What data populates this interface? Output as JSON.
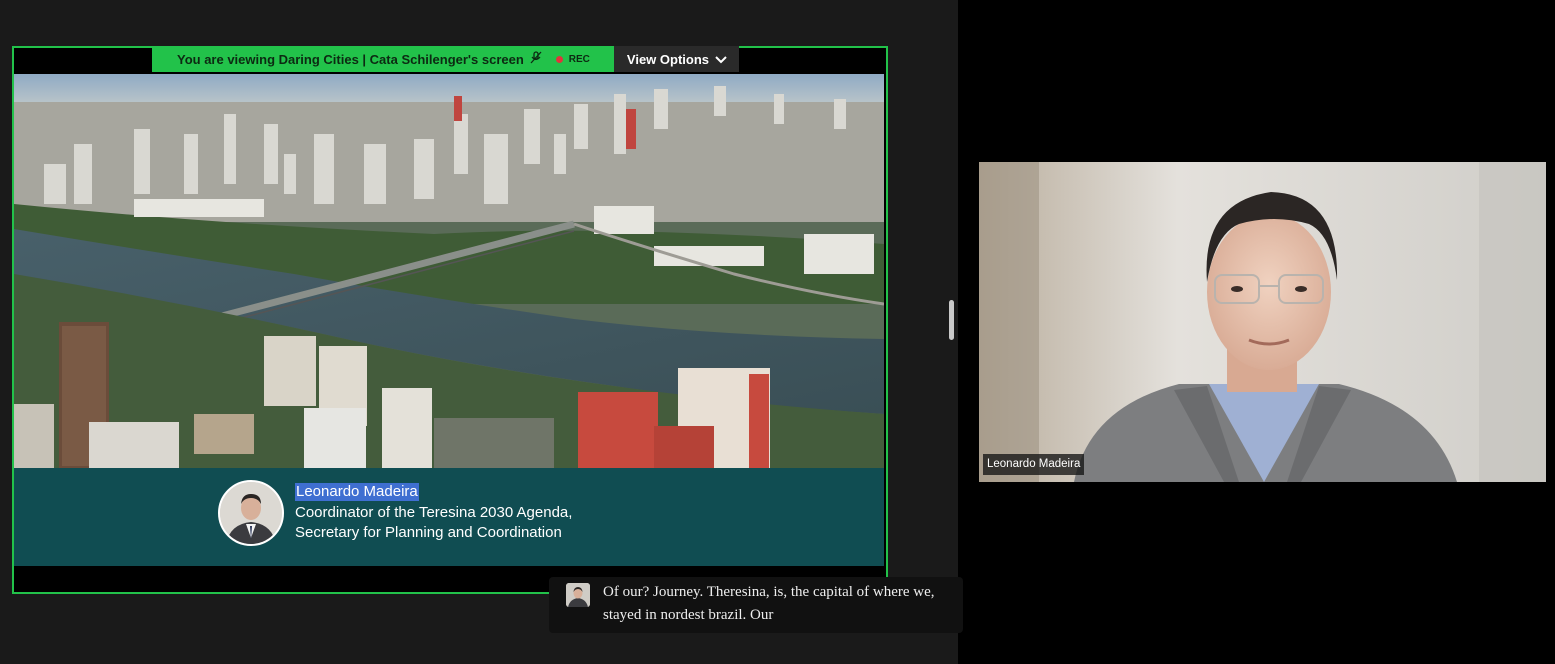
{
  "share_banner": {
    "viewing_text": "You are viewing  Daring Cities | Cata Schilenger's screen",
    "rec_label": "REC",
    "view_options_label": "View Options",
    "view_options_chevron": "⌄",
    "mic_icon": "mic-muted-icon"
  },
  "lower_third": {
    "name": "Leonardo Madeira",
    "title_line1": "Coordinator of the Teresina 2030 Agenda,",
    "title_line2": "Secretary for Planning and Coordination"
  },
  "live_caption": {
    "text": "Of our? Journey. Theresina, is, the capital of where we, stayed in nordest brazil. Our"
  },
  "participant": {
    "name": "Leonardo Madeira"
  },
  "colors": {
    "share_border": "#22c24a",
    "lower_third_bg": "#104d52",
    "name_highlight": "#3f6fd1",
    "rec_dot": "#e0353b"
  }
}
